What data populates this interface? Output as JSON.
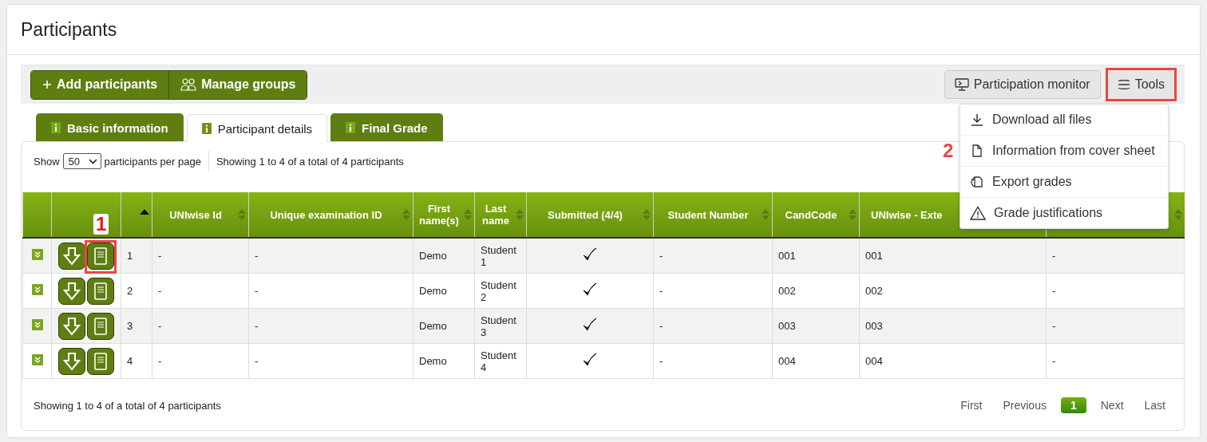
{
  "page_title": "Participants",
  "toolbar": {
    "left_buttons": [
      {
        "kind": "add",
        "label": "Add participants"
      },
      {
        "kind": "groups",
        "label": "Manage groups"
      }
    ],
    "monitor_button": {
      "label": "Participation monitor"
    },
    "tools_button": {
      "label": "Tools",
      "highlighted": true
    }
  },
  "tools_menu": [
    {
      "kind": "download",
      "label": "Download all files"
    },
    {
      "kind": "document",
      "label": "Information from cover sheet",
      "annotation": "2"
    },
    {
      "kind": "export",
      "label": "Export grades"
    },
    {
      "kind": "warning",
      "label": "Grade justifications"
    }
  ],
  "tabs": [
    {
      "label": "Basic information",
      "selected": false
    },
    {
      "label": "Participant details",
      "selected": true
    },
    {
      "label": "Final Grade",
      "selected": false
    }
  ],
  "page_size": {
    "prefix": "Show",
    "value": "50",
    "suffix": "participants per page"
  },
  "summary_top": "Showing 1 to 4 of a total of 4 participants",
  "columns": [
    {
      "sortable": false,
      "sorted": false
    },
    {
      "sortable": false,
      "sorted": false
    },
    {
      "sortable": true,
      "sorted": true
    },
    {
      "label": "UNIwise Id",
      "sortable": true,
      "sorted": false
    },
    {
      "label": "Unique examination ID",
      "sortable": true,
      "sorted": false
    },
    {
      "label": "First name(s)",
      "sortable": true,
      "sorted": false
    },
    {
      "label": "Last name",
      "sortable": true,
      "sorted": false
    },
    {
      "label": "Submitted (4/4)",
      "sortable": true,
      "sorted": false
    },
    {
      "label": "Student Number",
      "sortable": true,
      "sorted": false
    },
    {
      "label": "CandCode",
      "sortable": true,
      "sorted": false
    },
    {
      "label": "UNIwise - Exte",
      "sortable": false,
      "sorted": false
    },
    {
      "sortable": true,
      "sorted": false
    }
  ],
  "rows": [
    {
      "number": "1",
      "uniwise_id": "-",
      "unique_id": "-",
      "first_name": "Demo",
      "last_name": "Student 1",
      "submitted": true,
      "student_number": "-",
      "cand_code": "001",
      "external": "001",
      "column_12": "-",
      "highlighted": true,
      "annotation": "1"
    },
    {
      "number": "2",
      "uniwise_id": "-",
      "unique_id": "-",
      "first_name": "Demo",
      "last_name": "Student 2",
      "submitted": true,
      "student_number": "-",
      "cand_code": "002",
      "external": "002",
      "column_12": "-",
      "highlighted": false
    },
    {
      "number": "3",
      "uniwise_id": "-",
      "unique_id": "-",
      "first_name": "Demo",
      "last_name": "Student 3",
      "submitted": true,
      "student_number": "-",
      "cand_code": "003",
      "external": "003",
      "column_12": "-",
      "highlighted": false
    },
    {
      "number": "4",
      "uniwise_id": "-",
      "unique_id": "-",
      "first_name": "Demo",
      "last_name": "Student 4",
      "submitted": true,
      "student_number": "-",
      "cand_code": "004",
      "external": "004",
      "column_12": "-",
      "highlighted": false
    }
  ],
  "summary_bottom": "Showing 1 to 4 of a total of 4 participants",
  "pagination": [
    {
      "label": "First",
      "selected": false
    },
    {
      "label": "Previous",
      "selected": false
    },
    {
      "label": "1",
      "selected": true
    },
    {
      "label": "Next",
      "selected": false
    },
    {
      "label": "Last",
      "selected": false
    }
  ]
}
